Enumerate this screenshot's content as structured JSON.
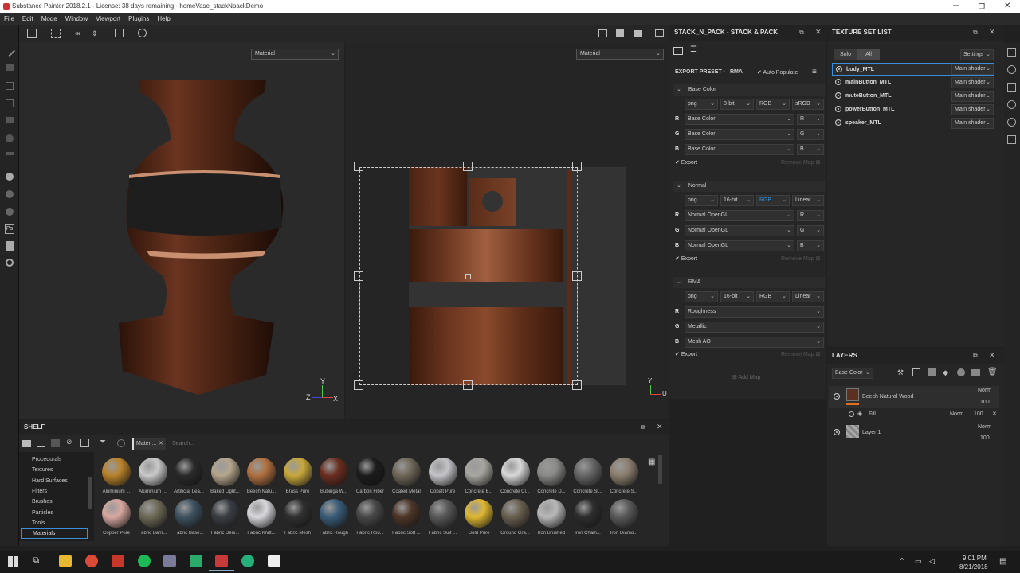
{
  "window": {
    "title": "Substance Painter 2018.2.1 - License: 38 days remaining - homeVase_stackNpackDemo"
  },
  "menu": [
    "File",
    "Edit",
    "Mode",
    "Window",
    "Viewport",
    "Plugins",
    "Help"
  ],
  "viewport": {
    "left_mode": "Material",
    "right_mode": "Material"
  },
  "stack": {
    "title": "STACK_N_PACK - STACK & PACK",
    "export_preset_label": "EXPORT PRESET -",
    "export_preset": "RMA",
    "auto_populate": "Auto Populate",
    "export_label": "Export",
    "remove_map": "Remove Map",
    "add_map": "Add Map",
    "maps": [
      {
        "name": "Base Color",
        "format": "png",
        "bits": "8-bit",
        "mode": "RGB",
        "space": "sRGB",
        "channels": [
          {
            "c": "R",
            "src": "Base Color",
            "ch": "R"
          },
          {
            "c": "G",
            "src": "Base Color",
            "ch": "G"
          },
          {
            "c": "B",
            "src": "Base Color",
            "ch": "B"
          }
        ]
      },
      {
        "name": "Normal",
        "format": "png",
        "bits": "16-bit",
        "mode": "RGB",
        "space": "Linear",
        "channels": [
          {
            "c": "R",
            "src": "Normal OpenGL",
            "ch": "R"
          },
          {
            "c": "G",
            "src": "Normal OpenGL",
            "ch": "G"
          },
          {
            "c": "B",
            "src": "Normal OpenGL",
            "ch": "B"
          }
        ]
      },
      {
        "name": "RMA",
        "format": "png",
        "bits": "16-bit",
        "mode": "RGB",
        "space": "Linear",
        "channels": [
          {
            "c": "R",
            "src": "Roughness",
            "ch": ""
          },
          {
            "c": "G",
            "src": "Metallic",
            "ch": ""
          },
          {
            "c": "B",
            "src": "Mesh AO",
            "ch": ""
          }
        ]
      }
    ]
  },
  "textureset": {
    "title": "TEXTURE SET LIST",
    "solo": "Solo",
    "all": "All",
    "settings": "Settings",
    "items": [
      {
        "name": "body_MTL",
        "shader": "Main shader"
      },
      {
        "name": "mainButton_MTL",
        "shader": "Main shader"
      },
      {
        "name": "muteButton_MTL",
        "shader": "Main shader"
      },
      {
        "name": "powerButton_MTL",
        "shader": "Main shader"
      },
      {
        "name": "speaker_MTL",
        "shader": "Main shader"
      }
    ]
  },
  "layers": {
    "title": "LAYERS",
    "channel": "Base Color",
    "items": [
      {
        "name": "Beech Natural Wood",
        "blend": "Norm",
        "opacity": "100"
      },
      {
        "name": "Fill",
        "blend": "Norm",
        "opacity": "100"
      },
      {
        "name": "Layer 1",
        "blend": "Norm",
        "opacity": "100"
      }
    ]
  },
  "shelf": {
    "title": "SHELF",
    "filter_tag": "Materi...",
    "search_placeholder": "Search...",
    "categories": [
      "Procedurals",
      "Textures",
      "Hard Surfaces",
      "Filters",
      "Brushes",
      "Particles",
      "Tools",
      "Materials"
    ],
    "materials": [
      {
        "name": "Aluminium ...",
        "color": "#b8822a"
      },
      {
        "name": "Aluminium ...",
        "color": "#c9c9c9"
      },
      {
        "name": "Artificial Lea...",
        "color": "#2a2a2a"
      },
      {
        "name": "Baked Light...",
        "color": "#b5a58c"
      },
      {
        "name": "Beech Natu...",
        "color": "#b07040"
      },
      {
        "name": "Brass Pure",
        "color": "#c8a83a"
      },
      {
        "name": "Bubinga W...",
        "color": "#6a2e20"
      },
      {
        "name": "Carbon Fiber",
        "color": "#1c1c1c"
      },
      {
        "name": "Coated Metal",
        "color": "#6e6658"
      },
      {
        "name": "Cobalt Pure",
        "color": "#c4c4c8"
      },
      {
        "name": "Concrete B...",
        "color": "#a8a6a0"
      },
      {
        "name": "Concrete Cl...",
        "color": "#d8d8d8"
      },
      {
        "name": "Concrete D...",
        "color": "#8a8a88"
      },
      {
        "name": "Concrete Sl...",
        "color": "#666666"
      },
      {
        "name": "Concrete S...",
        "color": "#8c7e6e"
      },
      {
        "name": "Copper Pure",
        "color": "#d8a8a0"
      },
      {
        "name": "Fabric Barn...",
        "color": "#6e6a58"
      },
      {
        "name": "Fabric Base...",
        "color": "#3e5260"
      },
      {
        "name": "Fabric Deni...",
        "color": "#3a3e44"
      },
      {
        "name": "Fabric Knitt...",
        "color": "#d8d8dc"
      },
      {
        "name": "Fabric Mesh",
        "color": "#303030"
      },
      {
        "name": "Fabric Rough",
        "color": "#3a5c78"
      },
      {
        "name": "Fabric Rou...",
        "color": "#484848"
      },
      {
        "name": "Fabric Soft ...",
        "color": "#4e3628"
      },
      {
        "name": "Fabric Suit ...",
        "color": "#585858"
      },
      {
        "name": "Gold Pure",
        "color": "#e0b830"
      },
      {
        "name": "Ground Gra...",
        "color": "#6a6050"
      },
      {
        "name": "Iron Brushed",
        "color": "#b8b8b8"
      },
      {
        "name": "Iron Chain...",
        "color": "#2e2e2e"
      },
      {
        "name": "Iron Diamo...",
        "color": "#5a5a5a"
      }
    ]
  },
  "taskbar": {
    "time": "9:01 PM",
    "date": "8/21/2018"
  },
  "colors": {
    "accent": "#3a8fd8",
    "wood": "#5a3020"
  }
}
